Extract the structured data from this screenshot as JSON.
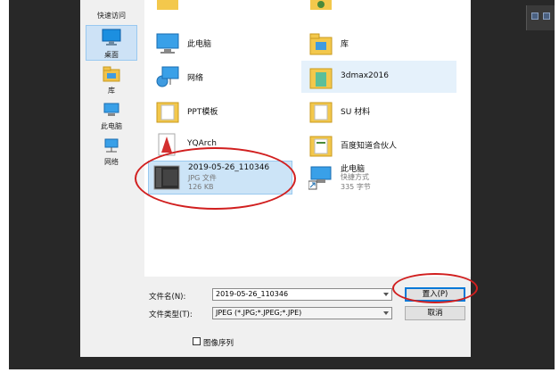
{
  "nav": {
    "quick_access": "快速访问",
    "items": [
      {
        "label": "桌面",
        "icon": "desktop-icon"
      },
      {
        "label": "库",
        "icon": "library-icon"
      },
      {
        "label": "此电脑",
        "icon": "this-pc-icon"
      },
      {
        "label": "网络",
        "icon": "network-icon"
      }
    ]
  },
  "files": [
    {
      "name": "此电脑",
      "icon": "this-pc-icon"
    },
    {
      "name": "库",
      "icon": "library-icon"
    },
    {
      "name": "网络",
      "icon": "network-icon"
    },
    {
      "name": "3dmax2016",
      "icon": "folder-icon"
    },
    {
      "name": "PPT模板",
      "icon": "folder-icon"
    },
    {
      "name": "SU 材料",
      "icon": "folder-icon"
    },
    {
      "name": "YQArch",
      "icon": "app-shortcut-icon"
    },
    {
      "name": "百度知道合伙人",
      "icon": "folder-icon"
    },
    {
      "name": "2019-05-26_110346",
      "type": "JPG 文件",
      "size": "126 KB",
      "icon": "image-thumbnail-icon"
    },
    {
      "name": "此电脑",
      "type": "快捷方式",
      "size": "335 字节",
      "icon": "shortcut-icon"
    }
  ],
  "bottom": {
    "filename_label": "文件名(N):",
    "filename_value": "2019-05-26_110346",
    "filetype_label": "文件类型(T):",
    "filetype_value": "JPEG (*.JPG;*.JPEG;*.JPE)",
    "place_button": "置入(P)",
    "cancel_button": "取消",
    "sequence_checkbox": "图像序列"
  },
  "colors": {
    "annotation": "#d11f1f",
    "selection": "#cce4f7",
    "accent": "#0078d7",
    "app_background": "#282828"
  }
}
